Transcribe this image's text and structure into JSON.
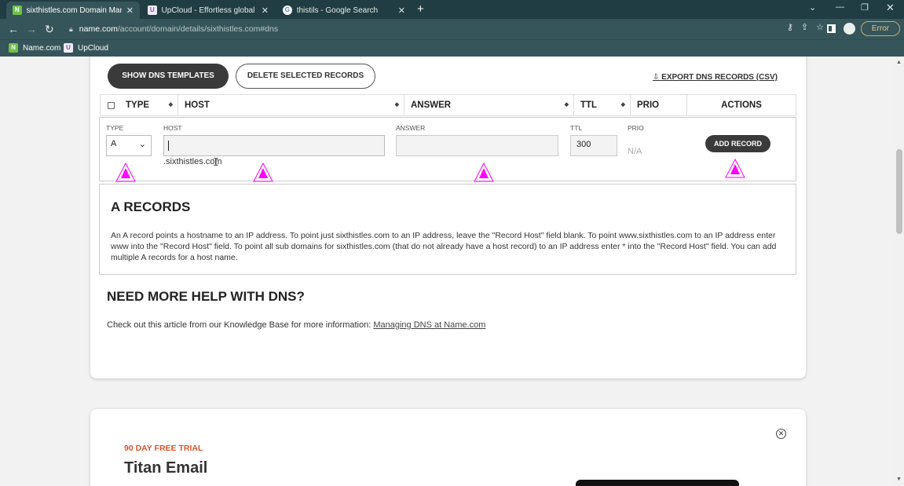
{
  "browser": {
    "tabs": [
      {
        "title": "sixthistles.com Domain Managem",
        "favicon": "N",
        "favicon_color": "#6fbf4a",
        "active": true
      },
      {
        "title": "UpCloud - Effortless global cloud",
        "favicon": "U",
        "favicon_color": "#7b4fd6",
        "active": false
      },
      {
        "title": "thistils - Google Search",
        "favicon": "G",
        "favicon_color": "#ffffff",
        "active": false
      }
    ],
    "new_tab": "+",
    "url_host": "name.com",
    "url_path": "/account/domain/details/sixthistles.com#dns",
    "error_label": "Error",
    "bookmarks": [
      {
        "label": "Name.com",
        "favicon": "N",
        "favicon_color": "#6fbf4a"
      },
      {
        "label": "UpCloud",
        "favicon": "U",
        "favicon_color": "#7b4fd6"
      }
    ]
  },
  "dns": {
    "show_templates_label": "SHOW DNS TEMPLATES",
    "delete_selected_label": "DELETE SELECTED RECORDS",
    "export_label": "EXPORT DNS RECORDS (CSV)",
    "columns": [
      "TYPE",
      "HOST",
      "ANSWER",
      "TTL",
      "PRIO",
      "ACTIONS"
    ],
    "form": {
      "type_label": "TYPE",
      "type_value": "A",
      "host_label": "HOST",
      "host_value": "",
      "answer_label": "ANSWER",
      "answer_value": "",
      "ttl_label": "TTL",
      "ttl_value": "300",
      "prio_label": "PRIO",
      "prio_value": "N/A",
      "domain_suffix": ".sixthistles.com",
      "add_record_label": "ADD RECORD"
    },
    "info": {
      "title": "A RECORDS",
      "text": "An A record points a hostname to an IP address. To point just sixthistles.com to an IP address, leave the \"Record Host\" field blank. To point www.sixthistles.com to an IP address enter www into the \"Record Host\" field. To point all sub domains for sixthistles.com (that do not already have a host record) to an IP address enter * into the \"Record Host\" field. You can add multiple A records for a host name."
    },
    "help": {
      "title": "NEED MORE HELP WITH DNS?",
      "text": "Check out this article from our Knowledge Base for more information: ",
      "link": "Managing DNS at Name.com"
    }
  },
  "promo": {
    "tag": "90 DAY FREE TRIAL",
    "title": "Titan Email"
  },
  "colors": {
    "marker": "#ff00ff",
    "promo_accent": "#d9562b",
    "chrome_dark": "#1f3d42"
  }
}
